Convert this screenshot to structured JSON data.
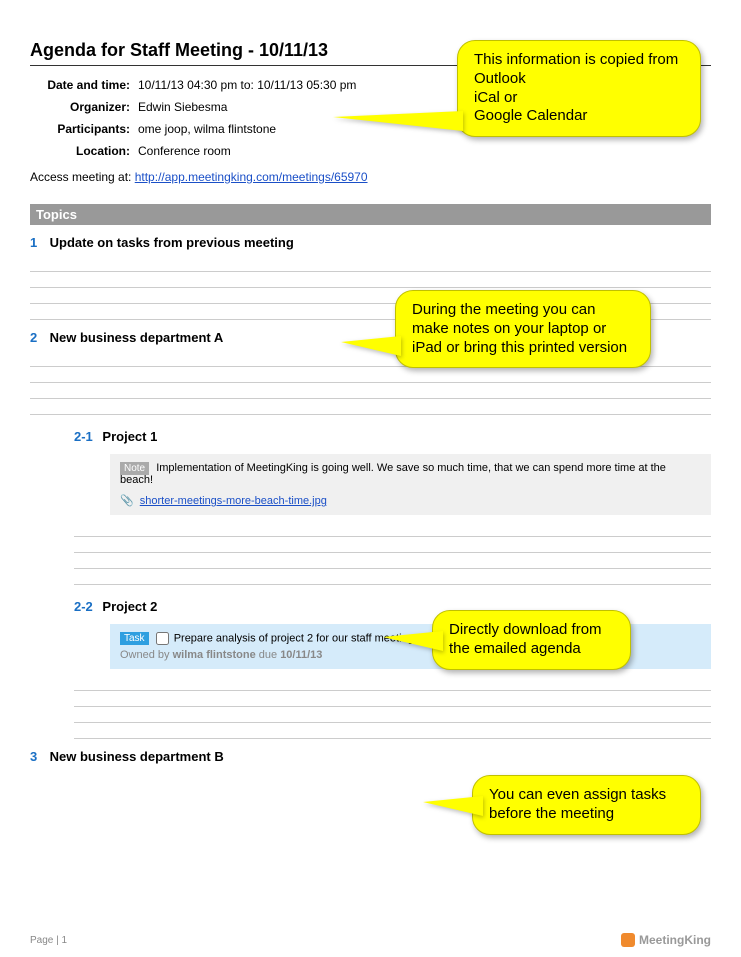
{
  "title": "Agenda for Staff Meeting - 10/11/13",
  "meta": {
    "dateLabel": "Date and time:",
    "dateValue": "10/11/13 04:30 pm to: 10/11/13 05:30 pm",
    "organizerLabel": "Organizer:",
    "organizerValue": "Edwin Siebesma",
    "participantsLabel": "Participants:",
    "participantsValue": "ome joop, wilma flintstone",
    "locationLabel": "Location:",
    "locationValue": "Conference room"
  },
  "access": {
    "prefix": "Access meeting at: ",
    "url": "http://app.meetingking.com/meetings/65970"
  },
  "topicsHeader": "Topics",
  "topics": {
    "t1": {
      "num": "1",
      "title": "Update on tasks from previous meeting"
    },
    "t2": {
      "num": "2",
      "title": "New business department A"
    },
    "t2_1": {
      "num": "2-1",
      "title": "Project 1"
    },
    "t2_2": {
      "num": "2-2",
      "title": "Project 2"
    },
    "t3": {
      "num": "3",
      "title": "New business department B"
    }
  },
  "note": {
    "badge": "Note",
    "text": "Implementation of MeetingKing is going well. We save so much time, that we can spend more time at the beach!",
    "attachment": "shorter-meetings-more-beach-time.jpg"
  },
  "task": {
    "badge": "Task",
    "text": "Prepare analysis of project 2 for our staff meeting.",
    "ownerPrefix": "Owned by ",
    "owner": "wilma flintstone",
    "duePrefix": "  due ",
    "due": "10/11/13"
  },
  "callouts": {
    "c1": "This information is copied from Outlook\niCal or\nGoogle Calendar",
    "c2": "During the meeting you can make notes on your laptop or iPad or bring this printed version",
    "c3": "Directly download from the emailed agenda",
    "c4": "You can even assign tasks before the meeting"
  },
  "footer": {
    "page": "Page | 1",
    "brand": "MeetingKing"
  }
}
